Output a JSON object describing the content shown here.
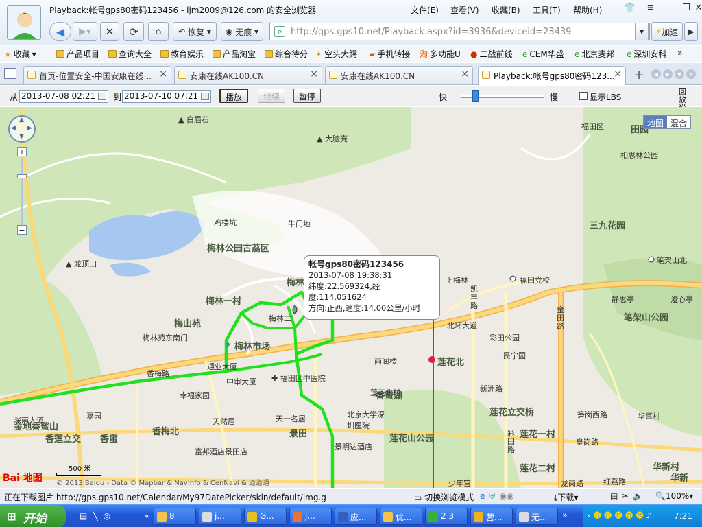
{
  "window": {
    "title": "Playback:帐号gps80密码123456 - ljm2009@126.com 的安全浏览器",
    "menu": [
      "文件(E)",
      "查看(V)",
      "收藏(B)",
      "工具(T)",
      "帮助(H)"
    ]
  },
  "toolbar": {
    "restore_label": "恢复",
    "incognito_label": "无痕",
    "accelerate_label": "加速",
    "url": "http://gps.gps10.net/Playback.aspx?id=3936&deviceid=23439"
  },
  "favorites": {
    "title": "收藏",
    "items": [
      "产品项目",
      "查询大全",
      "教育娱乐",
      "产品淘宝",
      "综合待分",
      "空头大鳄",
      "手机转接",
      "多功能U",
      "二战前线",
      "CEM华盛",
      "北京麦邦",
      "深圳安科"
    ]
  },
  "tabs": [
    {
      "label": "首页-位置安全-中国安康在线..."
    },
    {
      "label": "安康在线AK100.CN"
    },
    {
      "label": "安康在线AK100.CN"
    },
    {
      "label": "Playback:帐号gps80密码123..."
    }
  ],
  "controls": {
    "from_label": "从",
    "from_value": "2013-07-08 02:21",
    "to_label": "到",
    "to_value": "2013-07-10 07:21",
    "play_label": "播放",
    "continue_label": "继续",
    "pause_label": "暂停",
    "fast_label": "快",
    "slow_label": "慢",
    "speed_level": 0.15,
    "show_lbs_label": "显示LBS",
    "show_lbs_checked": false,
    "playback_help": "回放说明"
  },
  "map": {
    "type_map": "地图",
    "type_hybrid": "混合",
    "scale": "500 米",
    "copyright": "© 2013 Baidu - Data © Mapbar & NavInfo & CenNavi & 道道通",
    "logo": "Bai 地图",
    "route_color": "#22e020",
    "labels": [
      "白眉石",
      "大脑壳",
      "鸡楼坑",
      "牛门地",
      "梅林公园古荔区",
      "龙顶山",
      "梅林",
      "梅林一村",
      "梅林二",
      "梅林市场",
      "梅山苑",
      "梅林苑东南门",
      "通业大厦",
      "中审大厦",
      "福田区中医院",
      "幸福家园",
      "嘉园",
      "金地香蜜山",
      "香莲立交",
      "香蜜",
      "香梅北",
      "天然居",
      "天一名居",
      "景田",
      "富邦酒店景田店",
      "景明达酒店",
      "北京大学深圳医院",
      "香蜜湖",
      "上梅林",
      "福田党校",
      "彩田公园",
      "民宁园",
      "莲花北",
      "雨润楼",
      "莲花北村",
      "莲花山公园",
      "莲花立交桥",
      "莲花一村",
      "莲花二村",
      "少年宫",
      "笔架山公园",
      "笔架山北",
      "三九花园",
      "田园",
      "相思林公园",
      "静思亭",
      "澄心亭",
      "华新村",
      "华富村",
      "华新",
      "福田区",
      "北环大道",
      "深南大道",
      "皇岗路",
      "笋岗西路",
      "红荔路",
      "彩田路",
      "凯丰路",
      "新洲路",
      "香梅路",
      "龙岗路",
      "金田路"
    ]
  },
  "popup": {
    "title": "帐号gps80密码123456",
    "time": "2013-07-08 19:38:31",
    "coords": "纬度:22.569324,经度:114.051624",
    "heading": "方向:正西,速度:14.00公里/小时"
  },
  "status": {
    "text": "正在下载图片 http://gps.gps10.net/Calendar/My97DatePicker/skin/default/img.gif...",
    "view_mode": "切换浏览模式",
    "download": "下载",
    "zoom": "100%"
  },
  "taskbar": {
    "start": "开始",
    "items": [
      "8",
      "j...",
      "G...",
      "j...",
      "应...",
      "优...",
      "2 3",
      "营...",
      "无..."
    ],
    "clock": "7:21"
  }
}
